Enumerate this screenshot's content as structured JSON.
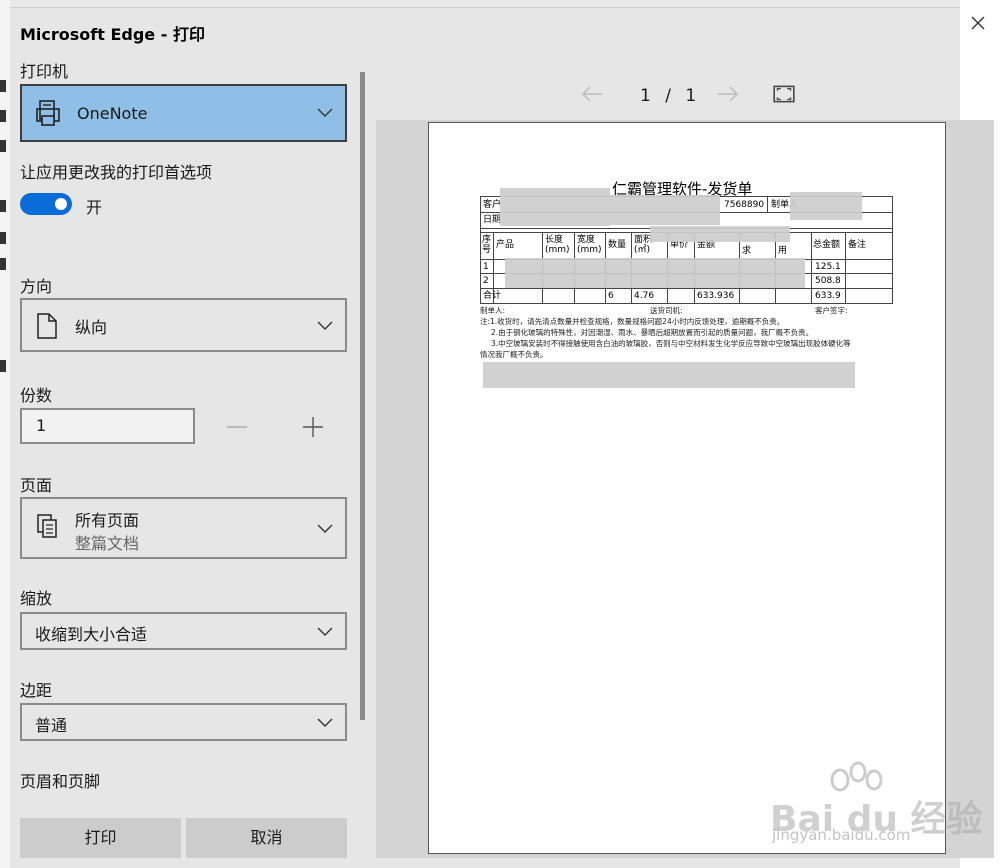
{
  "dialog": {
    "title": "Microsoft Edge - 打印"
  },
  "printer": {
    "label": "打印机",
    "value": "OneNote"
  },
  "app_prefs": {
    "label": "让应用更改我的打印首选项",
    "toggle_text": "开",
    "toggle_on": true
  },
  "orientation": {
    "label": "方向",
    "value": "纵向"
  },
  "copies": {
    "label": "份数",
    "value": "1"
  },
  "pages": {
    "label": "页面",
    "value": "所有页面",
    "sub": "整篇文档"
  },
  "scale": {
    "label": "缩放",
    "value": "收缩到大小合适"
  },
  "margins": {
    "label": "边距",
    "value": "普通"
  },
  "header_footer": {
    "label": "页眉和页脚"
  },
  "actions": {
    "print": "打印",
    "cancel": "取消"
  },
  "preview": {
    "current_page": "1",
    "separator": "/",
    "total_pages": "1",
    "doc": {
      "title": "仁霸管理软件-发货单",
      "row_labels": [
        "客户",
        "日期"
      ],
      "partial_phone": "7568890",
      "maker_short": "制单人",
      "headers": [
        "序号",
        "产品",
        "长度(mm)",
        "宽度(mm)",
        "数量",
        "面积(㎡)",
        "单价",
        "金额",
        "求",
        "用",
        "总金额",
        "备注"
      ],
      "rows": [
        {
          "no": "1",
          "total": "125.1"
        },
        {
          "no": "2",
          "total": "508.8"
        }
      ],
      "sum_row": {
        "label": "合计",
        "qty": "6",
        "area": "4.76",
        "amount": "633.936",
        "total": "633.9"
      },
      "footer": {
        "maker": "制单人:",
        "driver": "送货司机:",
        "customer": "客户签字:"
      },
      "notes": [
        "注:1.收货时，请先清点数量并检查规格，数量规格问题24小时内反馈处理，逾期概不负责。",
        "2.由于钢化玻璃的特殊性，对因潮湿、雨水、暴晒后超期放置而引起的质量问题，我厂概不负责。",
        "3.中空玻璃安装时不得接触使用含白油的玻璃胶，否则与中空材料发生化学反应导致中空玻璃出现胶体硬化等",
        "情况我厂概不负责。"
      ]
    }
  },
  "watermark": {
    "brand": "Bai du 经验",
    "url": "jingyan.baidu.com"
  },
  "colors": {
    "accent": "#0a6cd8",
    "printer_highlight": "#8fbfe6",
    "dialog_bg": "#e6e6e6"
  }
}
